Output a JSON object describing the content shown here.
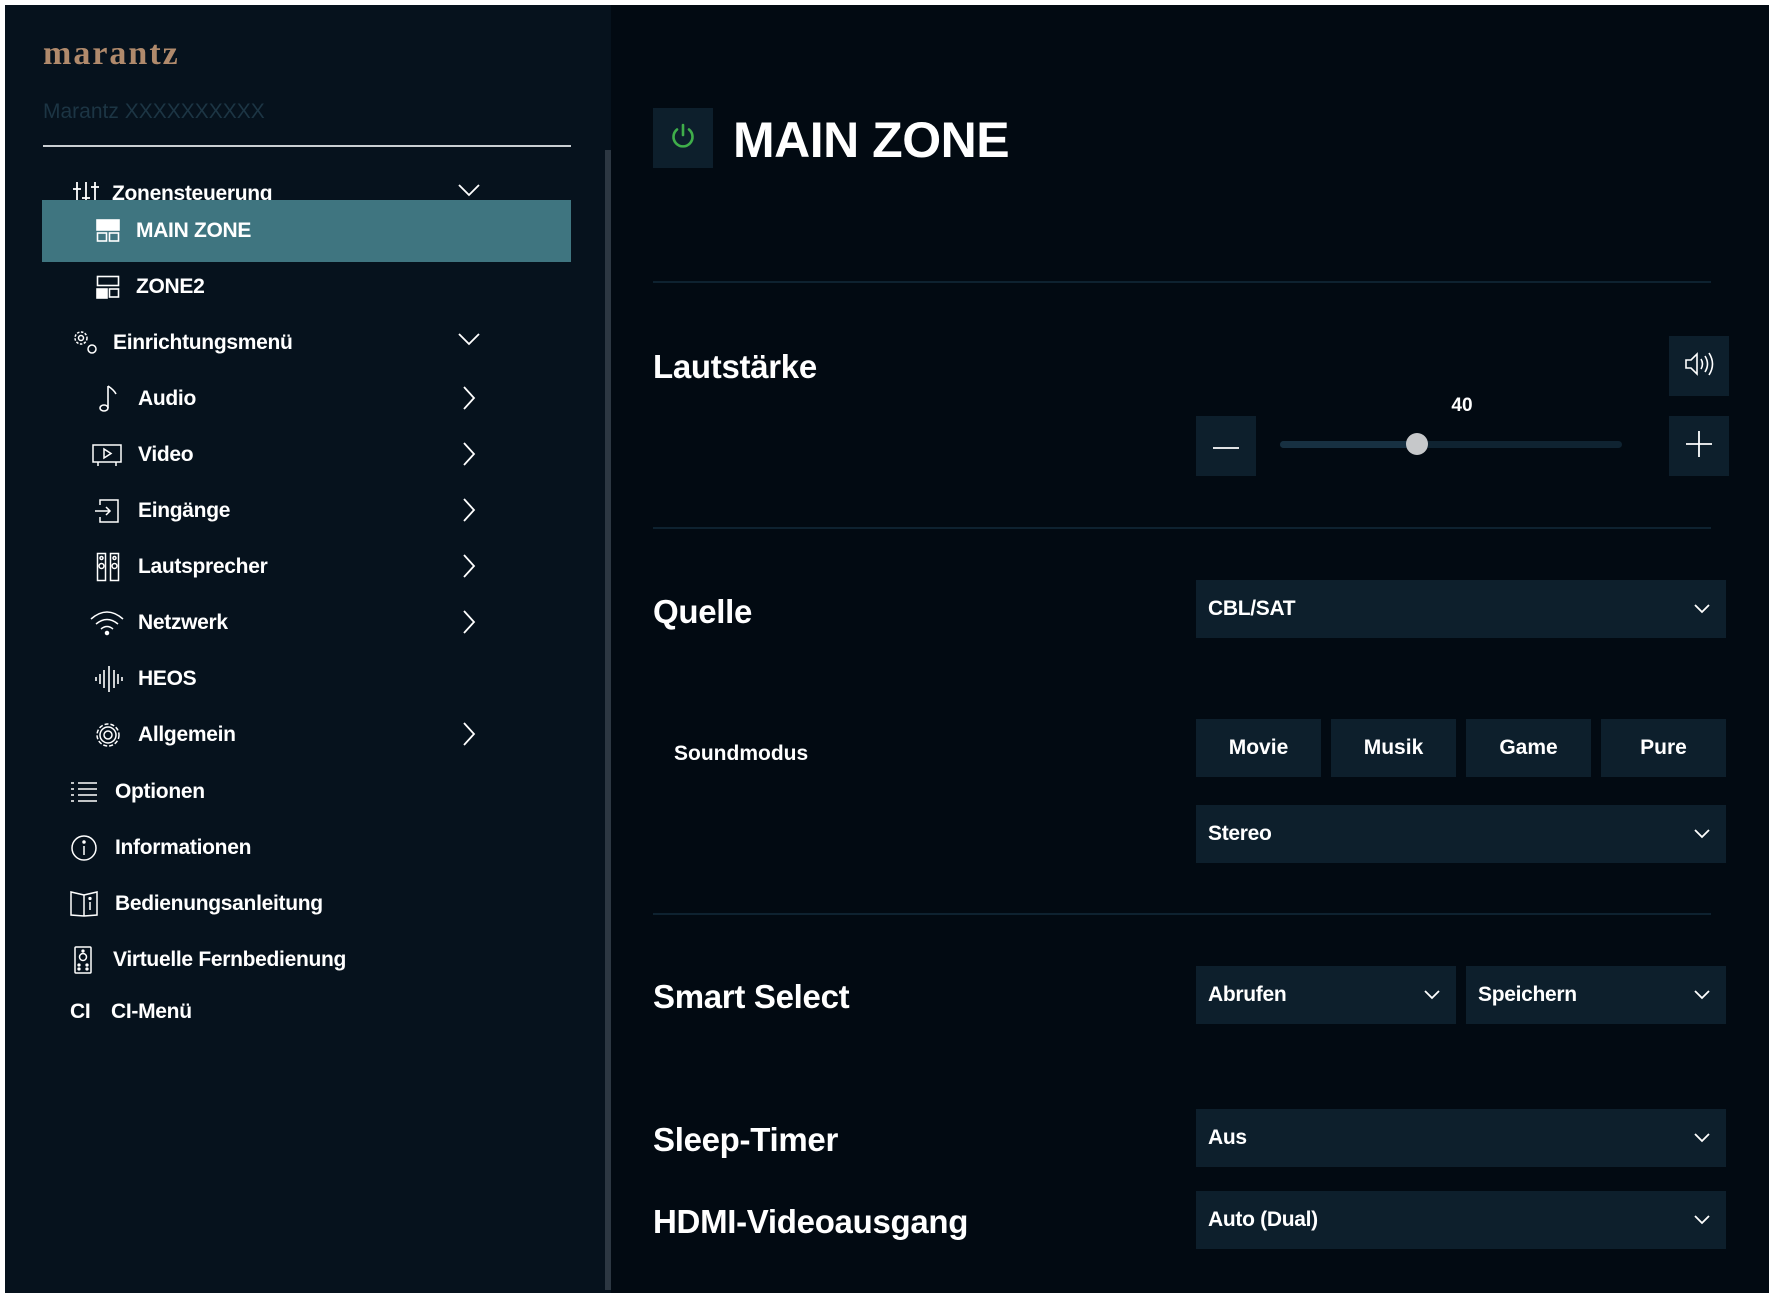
{
  "sidebar": {
    "brand": "marantz",
    "device_name": "Marantz XXXXXXXXXX",
    "items": [
      {
        "label": "Zonensteuerung",
        "icon": "sliders-icon"
      },
      {
        "label": "MAIN ZONE",
        "icon": "main-zone-icon"
      },
      {
        "label": "ZONE2",
        "icon": "zone2-icon"
      },
      {
        "label": "Einrichtungsmenü",
        "icon": "settings-gears-icon"
      },
      {
        "label": "Audio",
        "icon": "music-note-icon"
      },
      {
        "label": "Video",
        "icon": "video-icon"
      },
      {
        "label": "Eingänge",
        "icon": "input-icon"
      },
      {
        "label": "Lautsprecher",
        "icon": "speakers-icon"
      },
      {
        "label": "Netzwerk",
        "icon": "wifi-icon"
      },
      {
        "label": "HEOS",
        "icon": "heos-icon"
      },
      {
        "label": "Allgemein",
        "icon": "gear-icon"
      },
      {
        "label": "Optionen",
        "icon": "list-icon"
      },
      {
        "label": "Informationen",
        "icon": "info-icon"
      },
      {
        "label": "Bedienungsanleitung",
        "icon": "manual-icon"
      },
      {
        "label": "Virtuelle Fernbedienung",
        "icon": "remote-icon"
      },
      {
        "label": "CI-Menü",
        "icon": "ci-icon",
        "icon_text": "CI"
      }
    ]
  },
  "main": {
    "title": "MAIN ZONE",
    "volume": {
      "label": "Lautstärke",
      "value": "40",
      "level_fraction": 0.4
    },
    "source": {
      "label": "Quelle",
      "value": "CBL/SAT"
    },
    "soundmode": {
      "label": "Soundmodus",
      "buttons": [
        "Movie",
        "Musik",
        "Game",
        "Pure"
      ],
      "value": "Stereo"
    },
    "smart_select": {
      "label": "Smart Select",
      "recall": "Abrufen",
      "store": "Speichern"
    },
    "sleep_timer": {
      "label": "Sleep-Timer",
      "value": "Aus"
    },
    "hdmi_out": {
      "label": "HDMI-Videoausgang",
      "value": "Auto (Dual)"
    }
  },
  "colors": {
    "background": "#020a12",
    "sidebar": "#06121d",
    "active_item": "#3f7580",
    "control": "#0d1f2c",
    "power_green": "#3fae4a",
    "brand": "#b08a6c"
  }
}
